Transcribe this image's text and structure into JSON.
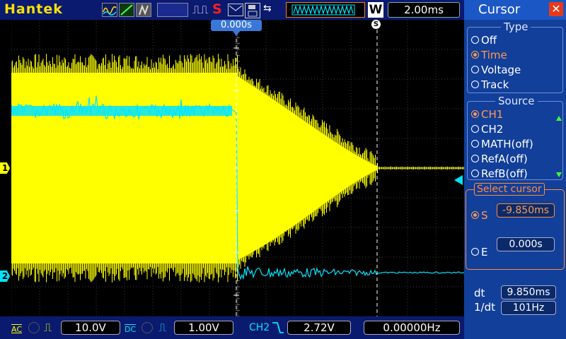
{
  "header": {
    "brand": "Hantek",
    "run_symbol": "⎍⎍",
    "stop_letter": "S",
    "usb_symbol": "⇆",
    "wave_button": "W",
    "timebase": "2.00ms",
    "trigger_time": "0.000s",
    "trigger_marker": "S"
  },
  "channels": {
    "ch1_marker": "1",
    "ch2_marker": "2",
    "ch1_color": "#ffff00",
    "ch2_color": "#00e5ff"
  },
  "bottom": {
    "ch1_coupling": "AC",
    "ch1_scale": "10.0V",
    "ch2_coupling": "DC",
    "ch2_scale": "1.00V",
    "trigger_source": "CH2",
    "trigger_level": "2.72V",
    "frequency": "0.00000Hz"
  },
  "panel": {
    "title": "Cursor",
    "close": "✕",
    "type_title": "Type",
    "type_options": [
      "Off",
      "Time",
      "Voltage",
      "Track"
    ],
    "type_selected": 1,
    "source_title": "Source",
    "source_options": [
      "CH1",
      "CH2",
      "MATH(off)",
      "RefA(off)",
      "RefB(off)"
    ],
    "source_selected": 0,
    "select_title": "Select cursor",
    "s_label": "S",
    "s_value": "-9.850ms",
    "e_label": "E",
    "e_value": "0.000s",
    "dt_label": "dt",
    "dt_value": "9.850ms",
    "inv_dt_label": "1/dt",
    "inv_dt_value": "101Hz"
  },
  "colors": {
    "accent_orange": "#ff8c3a",
    "panel_bg": "#123f9a",
    "bar_bg": "#0a1a6e"
  }
}
